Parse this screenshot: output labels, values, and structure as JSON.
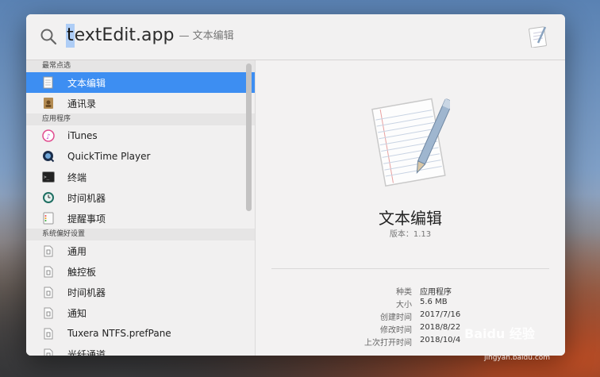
{
  "search": {
    "query_first_char": "t",
    "query_rest": "extEdit.app",
    "query_hint": "— 文本编辑"
  },
  "sidebar": {
    "sections": [
      {
        "header": "最常点选",
        "items": [
          {
            "label": "文本编辑",
            "icon": "textedit-icon",
            "selected": true
          },
          {
            "label": "通讯录",
            "icon": "contacts-icon"
          }
        ]
      },
      {
        "header": "应用程序",
        "items": [
          {
            "label": "iTunes",
            "icon": "itunes-icon"
          },
          {
            "label": "QuickTime Player",
            "icon": "quicktime-icon"
          },
          {
            "label": "终端",
            "icon": "terminal-icon"
          },
          {
            "label": "时间机器",
            "icon": "time-machine-icon"
          },
          {
            "label": "提醒事项",
            "icon": "reminders-icon"
          }
        ]
      },
      {
        "header": "系统偏好设置",
        "items": [
          {
            "label": "通用",
            "icon": "pref-file-icon"
          },
          {
            "label": "触控板",
            "icon": "pref-file-icon"
          },
          {
            "label": "时间机器",
            "icon": "pref-file-icon"
          },
          {
            "label": "通知",
            "icon": "pref-file-icon"
          },
          {
            "label": "Tuxera NTFS.prefPane",
            "icon": "pref-file-icon"
          },
          {
            "label": "光纤通道",
            "icon": "pref-file-icon"
          }
        ]
      }
    ]
  },
  "preview": {
    "app_name": "文本编辑",
    "version": "版本：1.13",
    "meta": [
      {
        "key": "种类",
        "value": "应用程序"
      },
      {
        "key": "大小",
        "value": "5.6 MB"
      },
      {
        "key": "创建时间",
        "value": "2017/7/16"
      },
      {
        "key": "修改时间",
        "value": "2018/8/22"
      },
      {
        "key": "上次打开时间",
        "value": "2018/10/4"
      }
    ]
  },
  "watermark": {
    "brand": "Baidu 经验",
    "url": "jingyan.baidu.com"
  },
  "colors": {
    "selection": "#3d8ef2",
    "query_highlight": "#aecdf6"
  }
}
